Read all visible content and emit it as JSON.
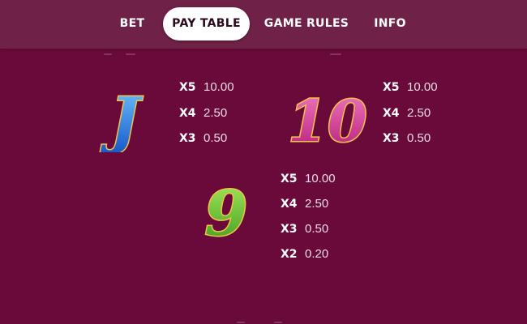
{
  "tabs": [
    {
      "label": "BET",
      "active": false
    },
    {
      "label": "PAY TABLE",
      "active": true
    },
    {
      "label": "GAME RULES",
      "active": false
    },
    {
      "label": "INFO",
      "active": false
    }
  ],
  "symbols": [
    {
      "glyph": "J",
      "color": "#2f7fe0",
      "payouts": [
        {
          "mult": "X5",
          "value": "10.00"
        },
        {
          "mult": "X4",
          "value": "2.50"
        },
        {
          "mult": "X3",
          "value": "0.50"
        }
      ]
    },
    {
      "glyph": "10",
      "color": "#d4308e",
      "payouts": [
        {
          "mult": "X5",
          "value": "10.00"
        },
        {
          "mult": "X4",
          "value": "2.50"
        },
        {
          "mult": "X3",
          "value": "0.50"
        }
      ]
    },
    {
      "glyph": "9",
      "color": "#5cba2c",
      "payouts": [
        {
          "mult": "X5",
          "value": "10.00"
        },
        {
          "mult": "X4",
          "value": "2.50"
        },
        {
          "mult": "X3",
          "value": "0.50"
        },
        {
          "mult": "X2",
          "value": "0.20"
        }
      ]
    }
  ],
  "colors": {
    "background": "#6a0a3a",
    "topbar": "#6f2147",
    "gold": "#e8b43a"
  }
}
